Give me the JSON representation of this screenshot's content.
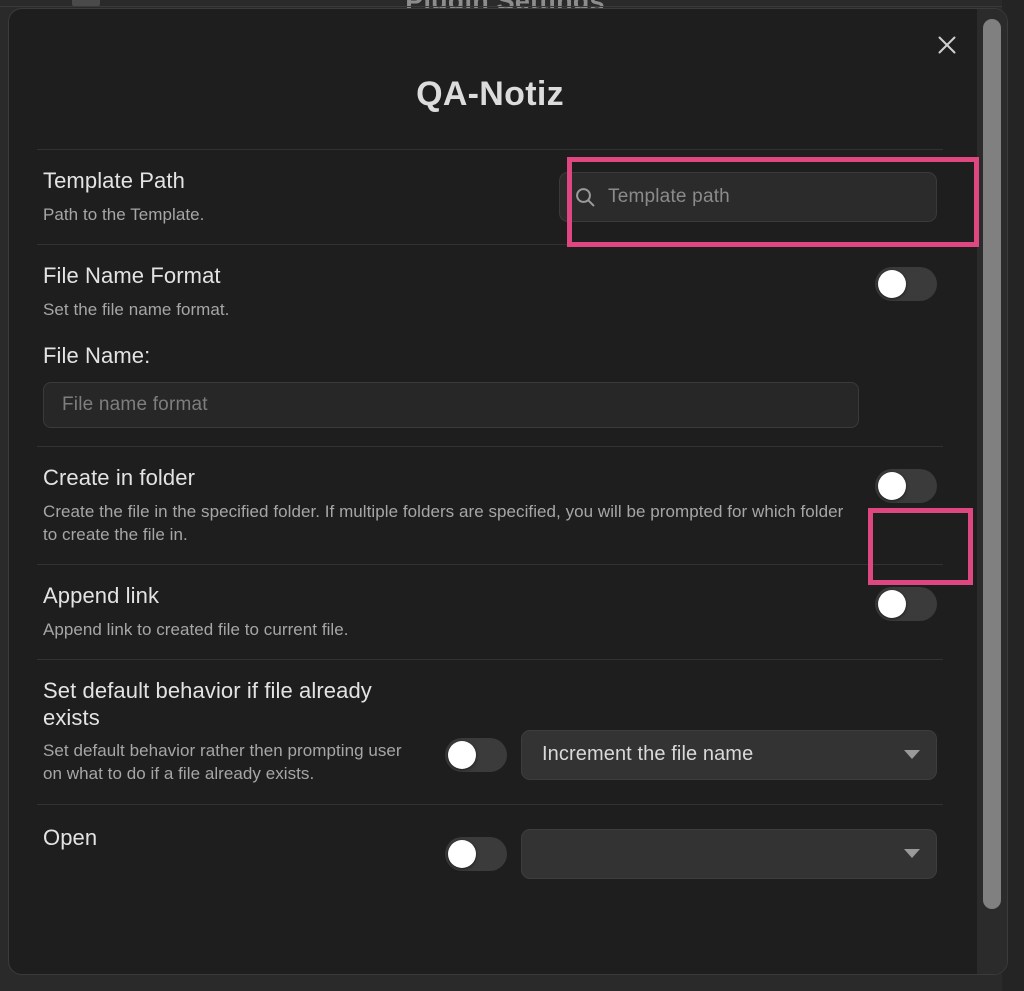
{
  "background": {
    "settings_title": "Plugin Settings",
    "ghost_labels": [
      "",
      "",
      ""
    ]
  },
  "modal": {
    "title": "QA-Notiz",
    "close_icon": "close-icon",
    "scrollbar": {
      "visible": true
    }
  },
  "settings": [
    {
      "id": "template-path",
      "name": "Template Path",
      "description": "Path to the Template.",
      "control": "search",
      "search": {
        "icon": "search-icon",
        "value": "",
        "placeholder": "Template path"
      },
      "highlighted": true
    },
    {
      "id": "file-name-format",
      "name": "File Name Format",
      "description": "Set the file name format.",
      "control": "toggle",
      "toggle": {
        "state": "off"
      },
      "sub_field": {
        "label": "File Name:",
        "value": "",
        "placeholder": "File name format"
      },
      "highlighted": false
    },
    {
      "id": "create-in-folder",
      "name": "Create in folder",
      "description": "Create the file in the specified folder. If multiple folders are specified, you will be prompted for which folder to create the file in.",
      "control": "toggle",
      "toggle": {
        "state": "off"
      },
      "highlighted": true
    },
    {
      "id": "append-link",
      "name": "Append link",
      "description": "Append link to created file to current file.",
      "control": "toggle",
      "toggle": {
        "state": "off"
      },
      "highlighted": false
    },
    {
      "id": "default-behavior-file-exists",
      "name": "Set default behavior if file already exists",
      "description": "Set default behavior rather then prompting user on what to do if a file already exists.",
      "control": "toggle-and-dropdown",
      "toggle": {
        "state": "off"
      },
      "dropdown": {
        "selected": "Increment the file name",
        "caret_icon": "chevron-down-icon"
      },
      "highlighted": false
    },
    {
      "id": "open",
      "name": "Open",
      "description": "",
      "control": "toggle-and-dropdown",
      "toggle": {
        "state": "off"
      },
      "dropdown": {
        "selected": "",
        "caret_icon": "chevron-down-icon"
      },
      "highlighted": false,
      "clipped": true
    }
  ],
  "colors": {
    "highlight_pink": "#DE4780",
    "modal_background": "#1E1E1E",
    "page_background": "#2A2A2A",
    "divider": "#323232",
    "toggle_track": "#3B3B3B",
    "toggle_knob": "#FFFFFF",
    "scrollbar_thumb": "#808080"
  }
}
